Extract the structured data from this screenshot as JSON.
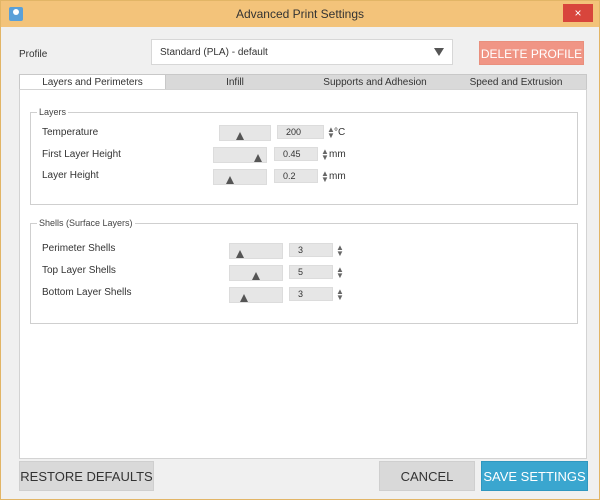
{
  "window": {
    "title": "Advanced Print Settings",
    "close_glyph": "×"
  },
  "profile": {
    "label": "Profile",
    "selected": "Standard (PLA)  -  default",
    "delete_label": "DELETE PROFILE"
  },
  "tabs": [
    {
      "label": "Layers and Perimeters"
    },
    {
      "label": "Infill"
    },
    {
      "label": "Supports and Adhesion"
    },
    {
      "label": "Speed and Extrusion"
    }
  ],
  "layers": {
    "legend": "Layers",
    "rows": [
      {
        "label": "Temperature",
        "value": "200",
        "unit": "°C"
      },
      {
        "label": "First Layer Height",
        "value": "0.45",
        "unit": "mm"
      },
      {
        "label": "Layer Height",
        "value": "0.2",
        "unit": "mm"
      }
    ]
  },
  "shells": {
    "legend": "Shells (Surface Layers)",
    "rows": [
      {
        "label": "Perimeter Shells",
        "value": "3"
      },
      {
        "label": "Top Layer Shells",
        "value": "5"
      },
      {
        "label": "Bottom Layer Shells",
        "value": "3"
      }
    ]
  },
  "buttons": {
    "restore": "RESTORE DEFAULTS",
    "cancel": "CANCEL",
    "save": "SAVE SETTINGS"
  },
  "colors": {
    "titlebar": "#f3c37a",
    "close": "#d8453c",
    "delete": "#f09585",
    "save": "#3aa6cf"
  },
  "icons": {
    "app": "app-icon",
    "close": "close-icon",
    "dropdown": "chevron-down-icon"
  }
}
